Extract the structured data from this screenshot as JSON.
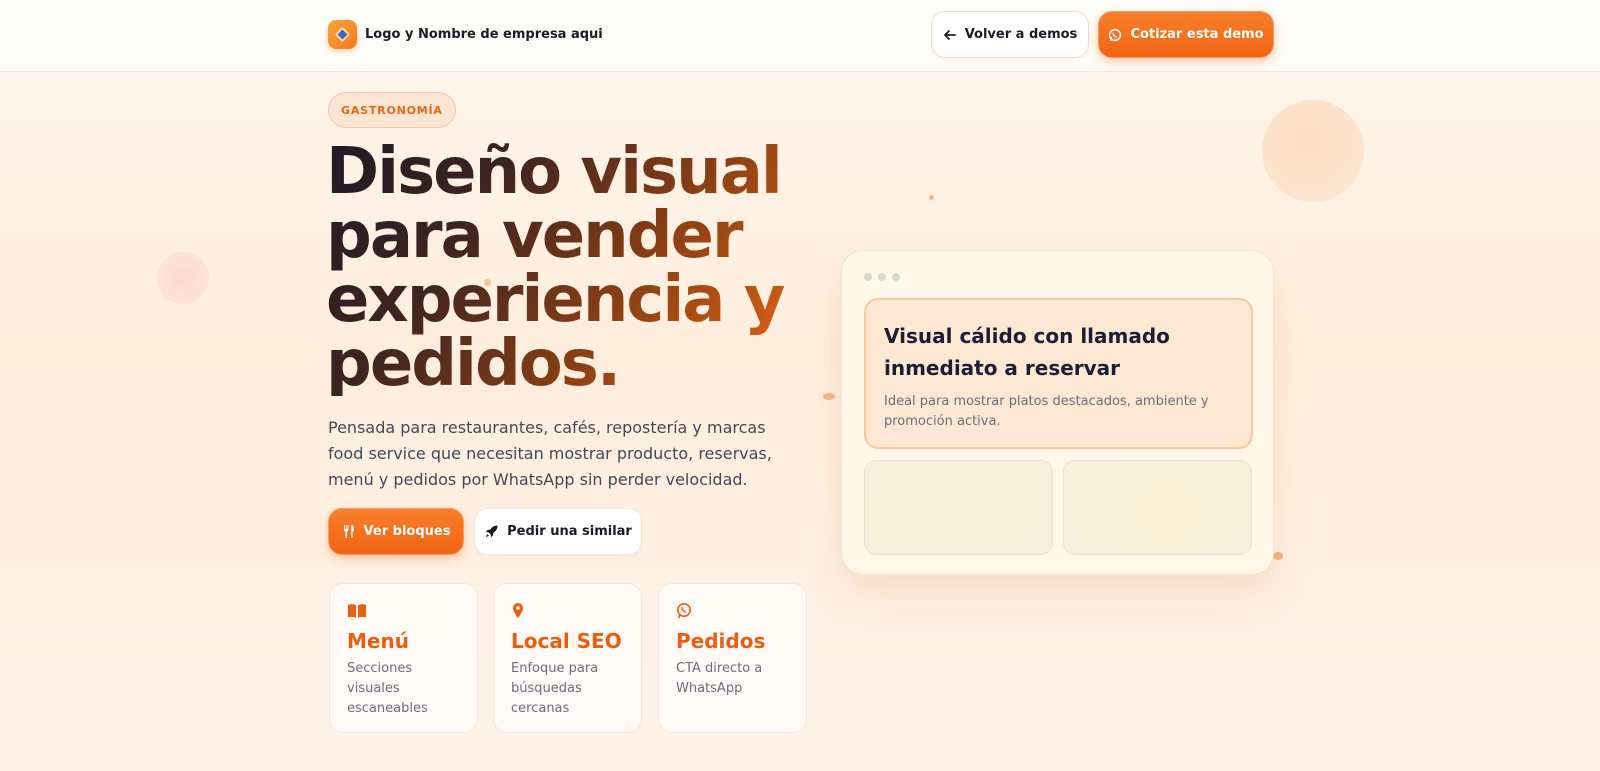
{
  "header": {
    "brand_name": "Logo y Nombre de empresa aqui",
    "back_label": "Volver a demos",
    "quote_label": "Cotizar esta demo"
  },
  "hero": {
    "tag": "GASTRONOMÍA",
    "headline_lines": [
      "Diseño visual",
      "para vender",
      "experiencia y",
      "pedidos."
    ],
    "subtitle": "Pensada para restaurantes, cafés, repostería y marcas food service que necesitan mostrar producto, reservas, menú y pedidos por WhatsApp sin perder velocidad.",
    "primary_label": "Ver bloques",
    "secondary_label": "Pedir una similar"
  },
  "features": [
    {
      "icon": "book-open-icon",
      "title": "Menú",
      "text": "Secciones visuales escaneables"
    },
    {
      "icon": "map-pin-icon",
      "title": "Local SEO",
      "text": "Enfoque para búsquedas cercanas"
    },
    {
      "icon": "whatsapp-icon",
      "title": "Pedidos",
      "text": "CTA directo a WhatsApp"
    }
  ],
  "preview": {
    "title": "Visual cálido con llamado inmediato a reservar",
    "text": "Ideal para mostrar platos destacados, ambiente y promoción activa."
  },
  "colors": {
    "accent": "#ef6414",
    "headline_dark": "#1f1a26",
    "text_muted": "#6a6e7e"
  }
}
